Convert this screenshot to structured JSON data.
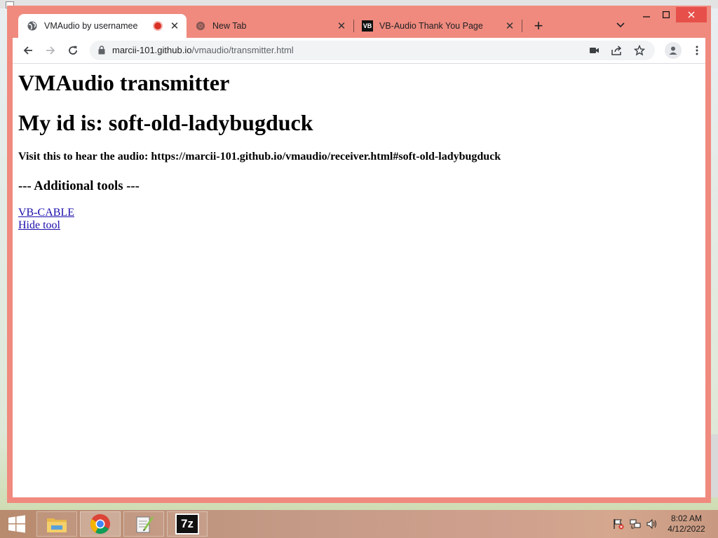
{
  "browser": {
    "tabs": [
      {
        "title": "VMAudio by usernamee",
        "active": true,
        "recording": true
      },
      {
        "title": "New Tab",
        "active": false
      },
      {
        "title": "VB-Audio Thank You Page",
        "active": false,
        "favicon_text": "VB"
      }
    ],
    "newtab_glyph": "+",
    "close_glyph": "✕",
    "url_host": "marcii-101.github.io",
    "url_path": "/vmaudio/transmitter.html",
    "colors": {
      "frame": "#f08a7e",
      "close": "#e7504a",
      "link": "#1a0dab"
    }
  },
  "page": {
    "heading": "VMAudio transmitter",
    "id_line": "My id is: soft-old-ladybugduck",
    "visit_line": "Visit this to hear the audio: https://marcii-101.github.io/vmaudio/receiver.html#soft-old-ladybugduck",
    "tools_heading": "--- Additional tools ---",
    "links": [
      "VB-CABLE",
      "Hide tool"
    ]
  },
  "taskbar": {
    "apps": [
      "file-explorer",
      "chrome",
      "notepad-plus-plus",
      "7-zip"
    ],
    "app_7z_label": "7z",
    "time": "8:02 AM",
    "date": "4/12/2022"
  }
}
